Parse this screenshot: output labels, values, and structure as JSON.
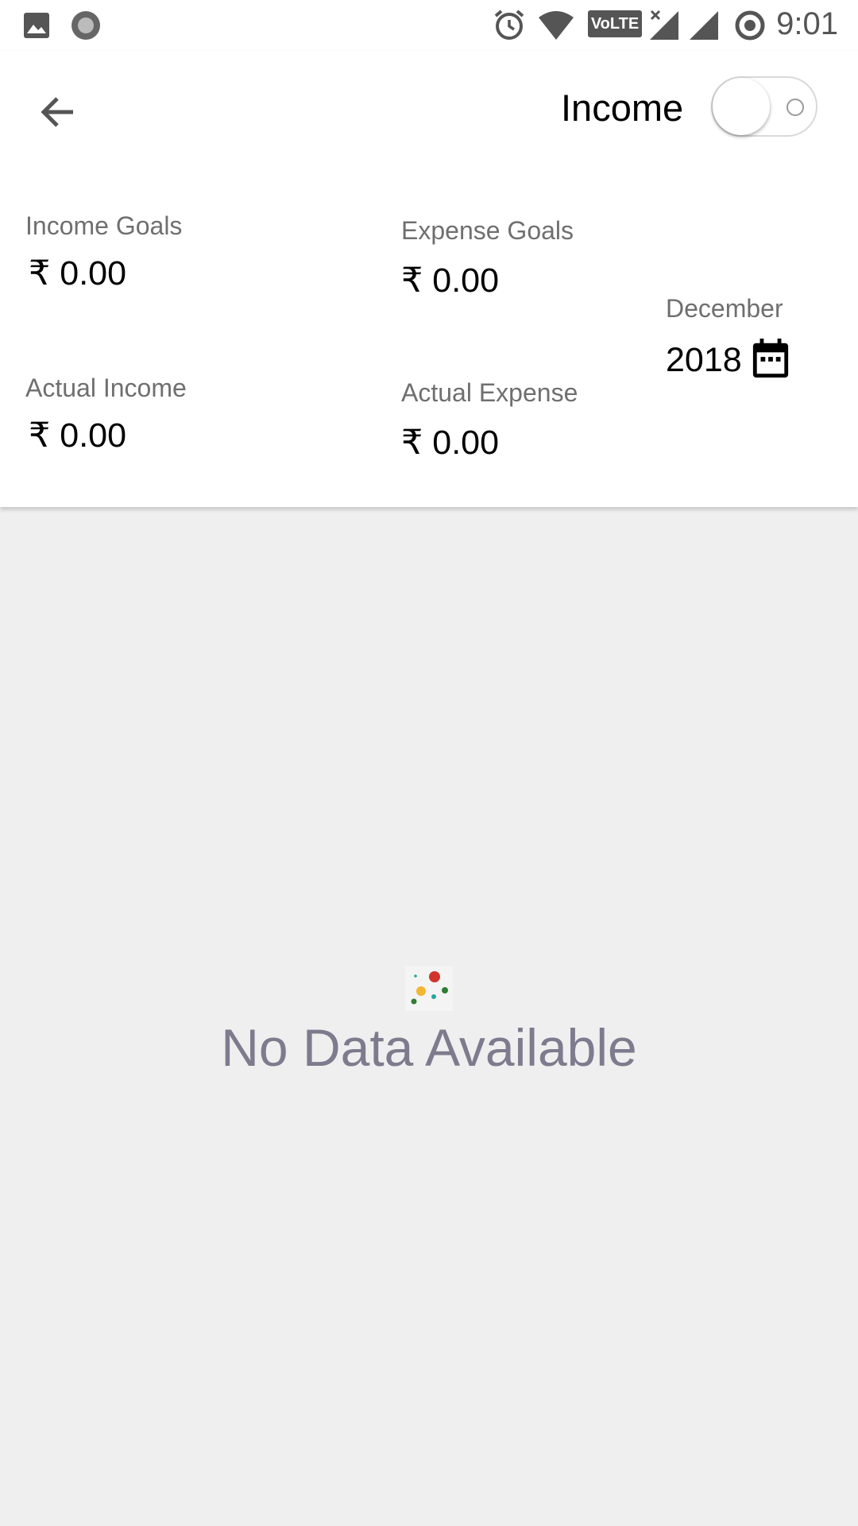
{
  "status_bar": {
    "time": "9:01",
    "icons": [
      "image-icon",
      "record-icon",
      "alarm-icon",
      "wifi-icon",
      "volte-icon",
      "signal-icon",
      "signal-icon",
      "sync-icon"
    ],
    "volte_label": "VoLTE"
  },
  "header": {
    "back_icon": "arrow-left-icon",
    "mode_label": "Income",
    "toggle_on": false
  },
  "summary": {
    "income_goals_label": "Income Goals",
    "income_goals_value": "₹ 0.00",
    "expense_goals_label": "Expense Goals",
    "expense_goals_value": "₹ 0.00",
    "actual_income_label": "Actual Income",
    "actual_income_value": "₹ 0.00",
    "actual_expense_label": "Actual Expense",
    "actual_expense_value": "₹ 0.00"
  },
  "date": {
    "month": "December",
    "year": "2018",
    "icon": "calendar-icon"
  },
  "empty_state": {
    "icon": "chart-dots-icon",
    "message": "No Data Available"
  },
  "colors": {
    "background": "#efefef",
    "panel": "#ffffff",
    "empty_text": "#7d7b8d",
    "dot_red": "#d0342c",
    "dot_yellow": "#f2b632",
    "dot_green": "#2e7d32",
    "dot_teal": "#26a69a"
  }
}
